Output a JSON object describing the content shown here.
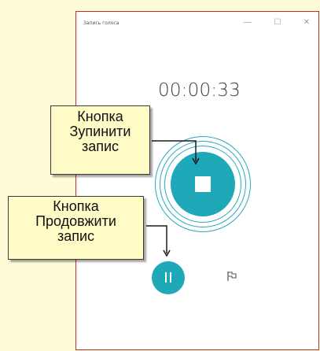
{
  "window": {
    "title": "Запись голоса",
    "controls": {
      "minimize": "—",
      "maximize": "☐",
      "close": "✕"
    }
  },
  "recorder": {
    "timer": "00:00:33"
  },
  "callouts": {
    "stop": {
      "line1": "Кнопка",
      "line2": "Зупинити",
      "line3": "запис"
    },
    "resume": {
      "line1": "Кнопка",
      "line2": "Продовжити",
      "line3": "запис"
    }
  },
  "colors": {
    "accent": "#1fa8b8",
    "window_border": "#c9302c",
    "callout_bg": "#fffbc6",
    "page_bg": "#fdfbd8"
  },
  "icons": {
    "stop": "stop-icon",
    "pause": "pause-icon",
    "flag": "flag-icon"
  }
}
